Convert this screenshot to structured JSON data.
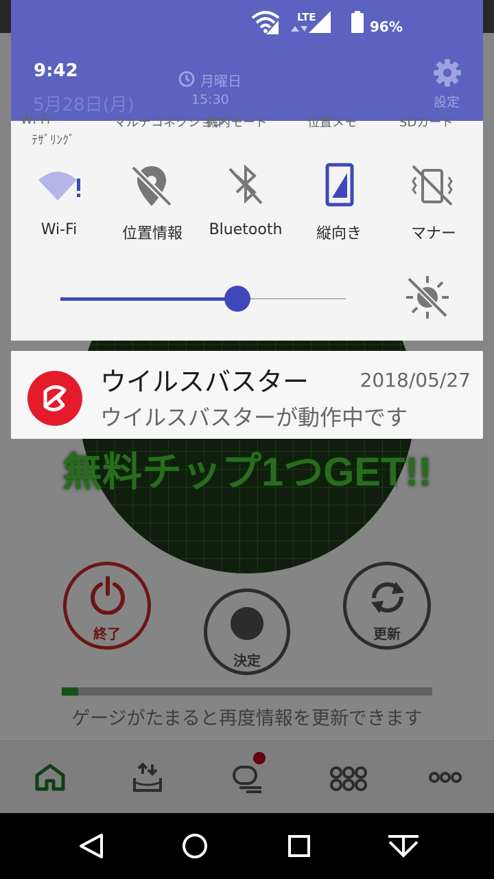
{
  "status_bar": {
    "signal_type": "LTE",
    "battery_percent": "96%"
  },
  "shade_header": {
    "time": "9:42",
    "date": "5月28日(月)",
    "alarm_day": "月曜日",
    "alarm_time": "15:30",
    "settings_label": "設定",
    "bg_color": "#5c62c0"
  },
  "quick_settings": {
    "faint_labels": [
      "Wi-Fi",
      "マルチコネクション",
      "機内モード",
      "位置メモ",
      "SDカード"
    ],
    "faint_sub": "ﾃｻﾞﾘﾝｸﾞ",
    "tiles": [
      {
        "label": "Wi-Fi",
        "icon": "wifi-warning-icon"
      },
      {
        "label": "位置情報",
        "icon": "location-off-icon"
      },
      {
        "label": "Bluetooth",
        "icon": "bluetooth-off-icon"
      },
      {
        "label": "縦向き",
        "icon": "portrait-lock-icon"
      },
      {
        "label": "マナー",
        "icon": "manner-mode-off-icon"
      }
    ],
    "brightness": {
      "level": 0.62,
      "auto_icon": "auto-brightness-off-icon"
    },
    "accent_color": "#3f48b8"
  },
  "notification": {
    "app_name": "ウイルスバスター",
    "date": "2018/05/27",
    "message": "ウイルスバスターが動作中です",
    "icon": "virusbuster-icon",
    "icon_color": "#e41b2a"
  },
  "background_app": {
    "promo_text": "無料チップ1つGET!!",
    "buttons": {
      "end": "終了",
      "decide": "決定",
      "refresh": "更新"
    },
    "gauge": {
      "level": 0.045,
      "caption": "ゲージがたまると再度情報を更新できます"
    },
    "bottom_nav": [
      "home-icon",
      "upload-tray-icon",
      "chat-icon",
      "grid-icon",
      "more-icon"
    ]
  },
  "system_nav": [
    "back-icon",
    "home-circle-icon",
    "recents-icon",
    "collapse-shade-icon"
  ]
}
